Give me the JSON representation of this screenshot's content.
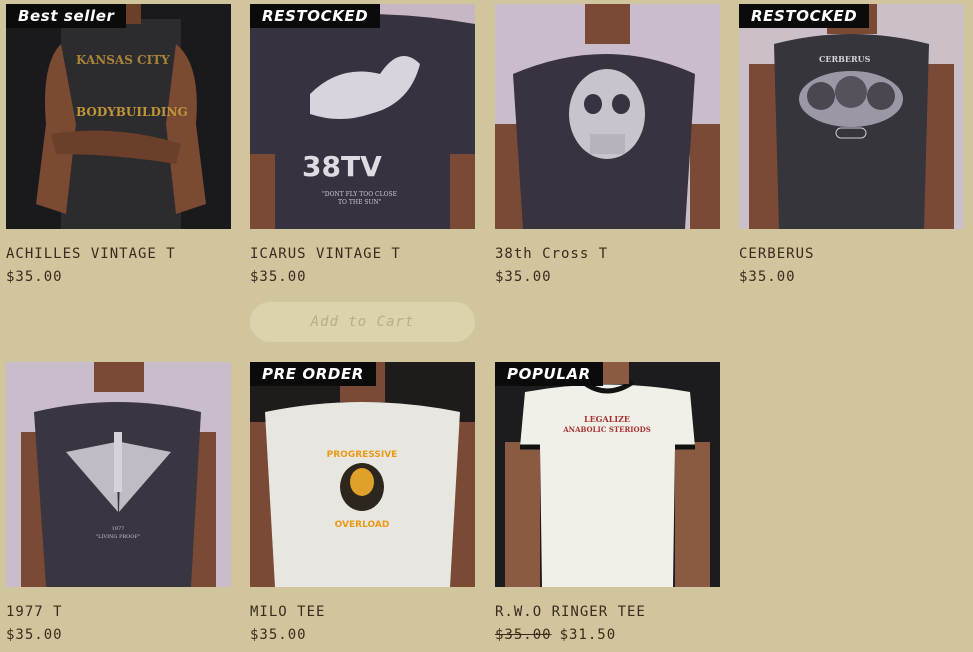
{
  "products": [
    {
      "badge": "Best seller",
      "title": "ACHILLES VINTAGE T",
      "price": "$35.00"
    },
    {
      "badge": "RESTOCKED",
      "title": "ICARUS VINTAGE T",
      "price": "$35.00",
      "print_text": "38TV",
      "print_sub": "\"DONT FLY TOO CLOSE TO THE SUN\""
    },
    {
      "badge": "",
      "title": "38th Cross T",
      "price": "$35.00"
    },
    {
      "badge": "RESTOCKED",
      "title": "CERBERUS",
      "price": "$35.00",
      "print_text": "CERBERUS"
    },
    {
      "badge": "",
      "title": "1977 T",
      "price": "$35.00"
    },
    {
      "badge": "PRE ORDER",
      "title": "MILO TEE",
      "price": "$35.00",
      "print_text": "PROGRESSIVE",
      "print_sub": "OVERLOAD"
    },
    {
      "badge": "POPULAR",
      "title": "R.W.O RINGER TEE",
      "price_old": "$35.00",
      "price": "$31.50",
      "print_text": "LEGALIZE",
      "print_sub": "ANABOLIC STERIODS"
    }
  ],
  "add_to_cart_label": "Add to Cart",
  "colors": {
    "background": "#d1c59e",
    "text": "#3a2b1c",
    "badge_bg": "#0b0b0b"
  }
}
